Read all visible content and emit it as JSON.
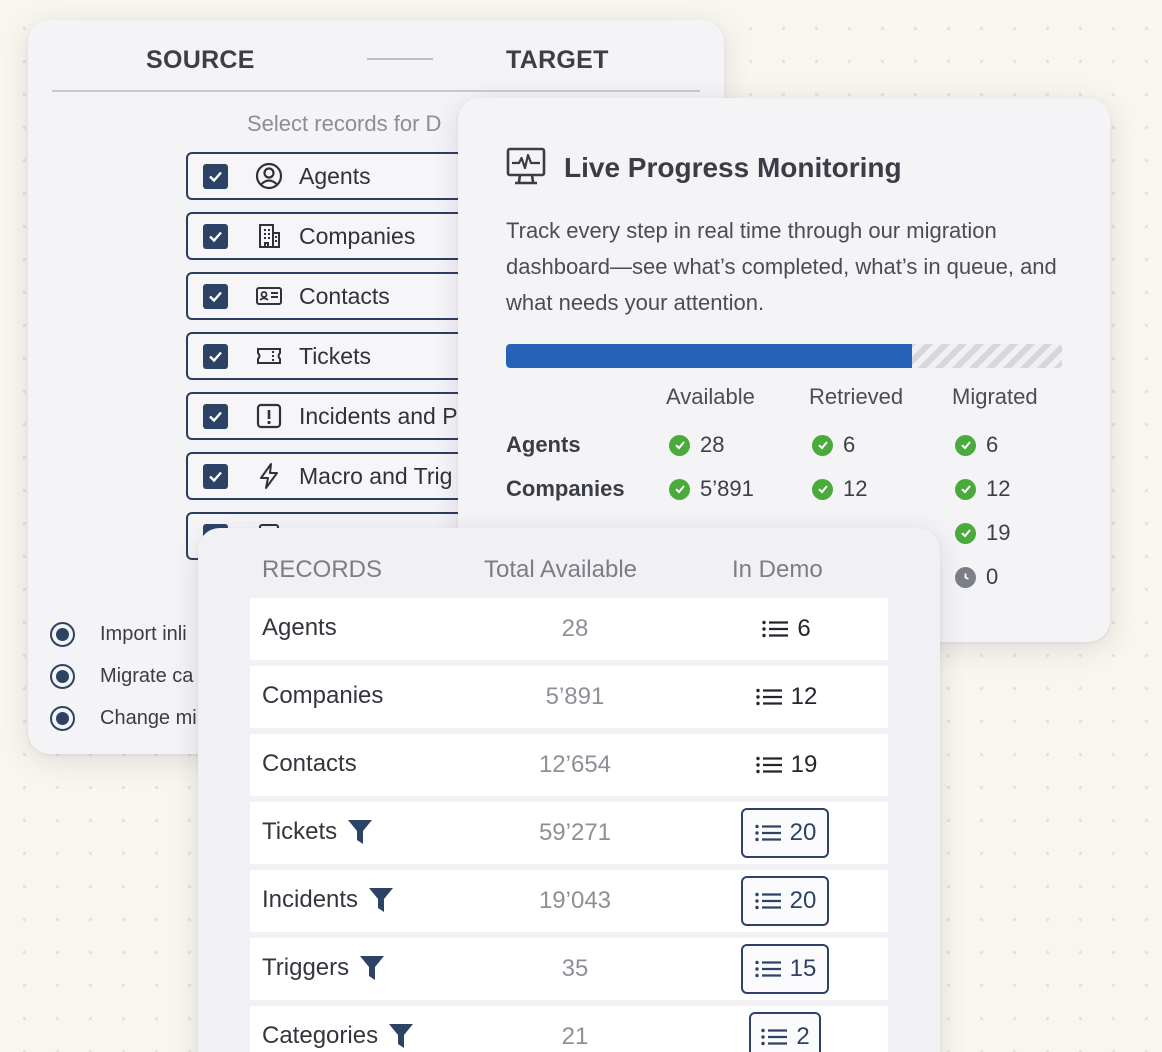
{
  "source_panel": {
    "source_label": "SOURCE",
    "target_label": "TARGET",
    "select_text": "Select records for D",
    "records": [
      {
        "label": "Agents",
        "icon": "user-circle-icon",
        "checked": true
      },
      {
        "label": "Companies",
        "icon": "building-icon",
        "checked": true
      },
      {
        "label": "Contacts",
        "icon": "id-card-icon",
        "checked": true
      },
      {
        "label": "Tickets",
        "icon": "ticket-icon",
        "checked": true
      },
      {
        "label": "Incidents and P",
        "icon": "alert-square-icon",
        "checked": true
      },
      {
        "label": "Macro and Trig",
        "icon": "lightning-icon",
        "checked": true
      }
    ],
    "options": [
      {
        "label": "Import inli",
        "selected": true
      },
      {
        "label": "Migrate ca",
        "selected": true
      },
      {
        "label": "Change mi",
        "selected": true
      }
    ]
  },
  "progress_panel": {
    "icon": "monitor-pulse-icon",
    "title": "Live Progress Monitoring",
    "description": "Track every step in real time through our migration dashboard—see what’s completed, what’s in queue, and what needs your attention.",
    "progress_fraction": 0.73,
    "columns": [
      "Available",
      "Retrieved",
      "Migrated"
    ],
    "rows": [
      {
        "label": "Agents",
        "available": "28",
        "retrieved": "6",
        "migrated": "6"
      },
      {
        "label": "Companies",
        "available": "5’891",
        "retrieved": "12",
        "migrated": "12"
      },
      {
        "label": "",
        "available": "",
        "retrieved": "",
        "migrated": "19"
      },
      {
        "label": "",
        "available": "",
        "retrieved": "",
        "migrated": "0",
        "status": "pending"
      }
    ]
  },
  "records_panel": {
    "headers": {
      "records": "RECORDS",
      "total": "Total Available",
      "demo": "In Demo"
    },
    "rows": [
      {
        "name": "Agents",
        "total": "28",
        "demo": "6",
        "filter": false,
        "boxed": false
      },
      {
        "name": "Companies",
        "total": "5’891",
        "demo": "12",
        "filter": false,
        "boxed": false
      },
      {
        "name": "Contacts",
        "total": "12’654",
        "demo": "19",
        "filter": false,
        "boxed": false
      },
      {
        "name": "Tickets",
        "total": "59’271",
        "demo": "20",
        "filter": true,
        "boxed": true
      },
      {
        "name": "Incidents",
        "total": "19’043",
        "demo": "20",
        "filter": true,
        "boxed": true
      },
      {
        "name": "Triggers",
        "total": "35",
        "demo": "15",
        "filter": true,
        "boxed": true
      },
      {
        "name": "Categories",
        "total": "21",
        "demo": "2",
        "filter": true,
        "boxed": true
      }
    ]
  },
  "colors": {
    "navy": "#2d4366",
    "progress_blue": "#2762b9",
    "check_green": "#4aaa3c",
    "background": "#f8f6ee"
  }
}
